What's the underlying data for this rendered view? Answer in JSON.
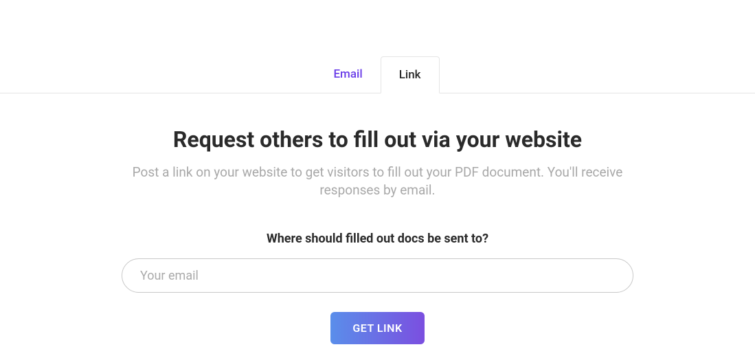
{
  "tabs": {
    "email": {
      "label": "Email"
    },
    "link": {
      "label": "Link"
    }
  },
  "content": {
    "heading": "Request others to fill out via your website",
    "subheading": "Post a link on your website to get visitors to fill out your PDF document. You'll receive responses by email."
  },
  "form": {
    "label": "Where should filled out docs be sent to?",
    "placeholder": "Your email",
    "value": "",
    "button_label": "GET LINK"
  }
}
